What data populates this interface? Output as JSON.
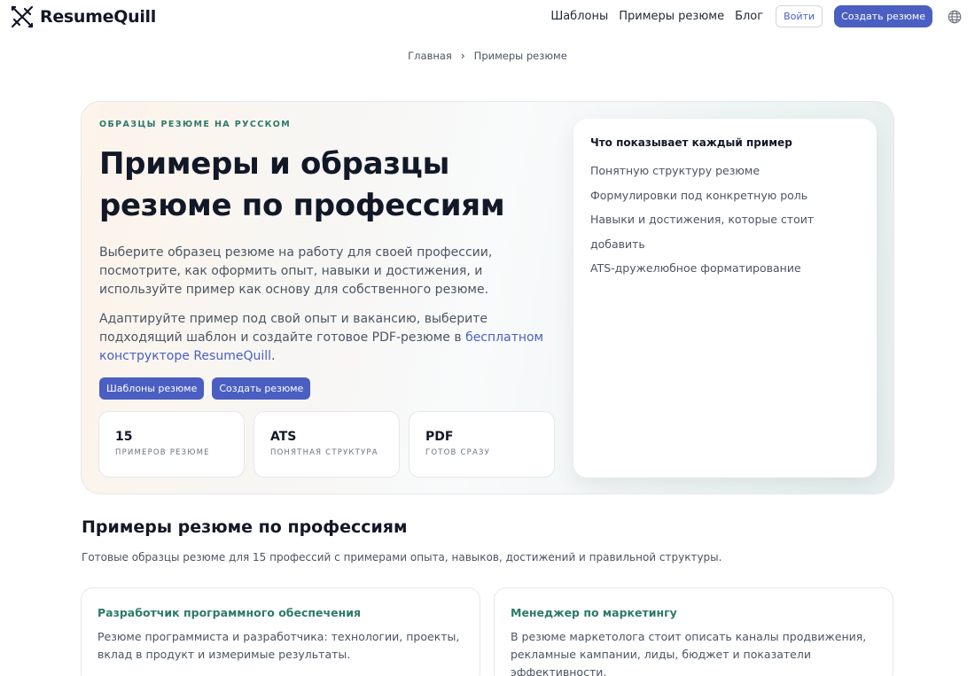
{
  "header": {
    "logo_text": "ResumeQuill",
    "nav": [
      "Шаблоны",
      "Примеры резюме",
      "Блог"
    ],
    "login_label": "Войти",
    "create_label": "Создать резюме"
  },
  "breadcrumb": {
    "home": "Главная",
    "separator": "›",
    "current": "Примеры резюме"
  },
  "hero": {
    "eyebrow": "ОБРАЗЦЫ РЕЗЮМЕ НА РУССКОМ",
    "title": "Примеры и образцы резюме по профессиям",
    "paragraph1": "Выберите образец резюме на работу для своей профессии, посмотрите, как оформить опыт, навыки и достижения, и используйте пример как основу для собственного резюме.",
    "paragraph2_text": "Адаптируйте пример под свой опыт и вакансию, выберите подходящий шаблон и создайте готовое PDF-резюме в ",
    "paragraph2_link": "бесплатном конструкторе ResumeQuill",
    "paragraph2_end": ".",
    "buttons": [
      "Шаблоны резюме",
      "Создать резюме"
    ],
    "stats": [
      {
        "value": "15",
        "label": "ПРИМЕРОВ РЕЗЮМЕ"
      },
      {
        "value": "ATS",
        "label": "ПОНЯТНАЯ СТРУКТУРА"
      },
      {
        "value": "PDF",
        "label": "ГОТОВ СРАЗУ"
      }
    ],
    "side_card": {
      "title": "Что показывает каждый пример",
      "items": [
        "Понятную структуру резюме",
        "Формулировки под конкретную роль",
        "Навыки и достижения, которые стоит добавить",
        "ATS-дружелюбное форматирование"
      ]
    }
  },
  "professions": {
    "title": "Примеры резюме по профессиям",
    "subtitle": "Готовые образцы резюме для 15 профессий с примерами опыта, навыков, достижений и правильной структуры.",
    "cards": [
      {
        "title": "Разработчик программного обеспечения",
        "text": "Резюме программиста и разработчика: технологии, проекты, вклад в продукт и измеримые результаты."
      },
      {
        "title": "Менеджер по маркетингу",
        "text": "В резюме маркетолога стоит описать каналы продвижения, рекламные кампании, лиды, бюджет и показатели эффективности."
      }
    ]
  },
  "colors": {
    "accent": "#4a5fc1",
    "teal": "#2c7a6b"
  },
  "icons": [
    "quill-logo-icon",
    "globe-icon",
    "chevron-right-icon"
  ]
}
